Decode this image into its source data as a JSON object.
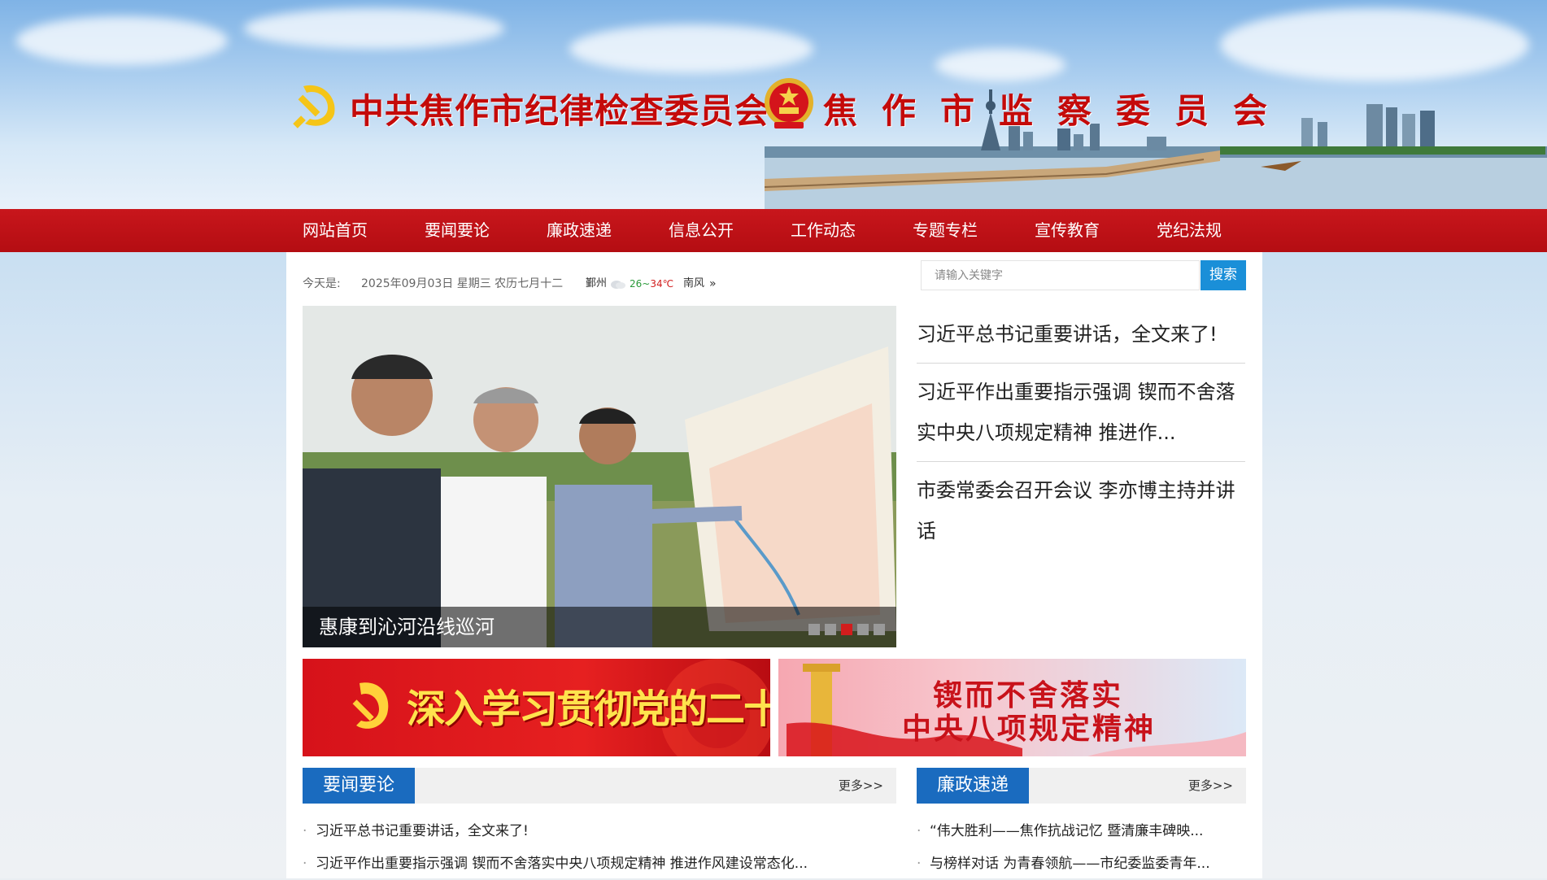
{
  "header": {
    "org_title_1": "中共焦作市纪律检查委员会",
    "org_title_2": "焦作市监察委员会"
  },
  "nav": {
    "items": [
      "网站首页",
      "要闻要论",
      "廉政速递",
      "信息公开",
      "工作动态",
      "专题专栏",
      "宣传教育",
      "党纪法规"
    ]
  },
  "datebar": {
    "label": "今天是:",
    "date": "2025年09月03日 星期三 农历七月十二",
    "city": "鄞州",
    "temp_low": "26",
    "temp_sep": "~",
    "temp_high": "34℃",
    "wind": "南风",
    "more": "»"
  },
  "search": {
    "placeholder": "请输入关键字",
    "button": "搜索"
  },
  "carousel": {
    "caption": "惠康到沁河沿线巡河",
    "active_index": 2,
    "slide_count": 5
  },
  "headlines": [
    "习近平总书记重要讲话，全文来了!",
    "习近平作出重要指示强调 锲而不舍落实中央八项规定精神 推进作...",
    "市委常委会召开会议 李亦博主持并讲话"
  ],
  "ads": {
    "ad1_text": "深入学习贯彻党的二十大精神",
    "ad2_line1": "锲而不舍落实",
    "ad2_line2": "中央八项规定精神"
  },
  "sections": {
    "left": {
      "title": "要闻要论",
      "more": "更多>>",
      "items": [
        "习近平总书记重要讲话，全文来了!",
        "习近平作出重要指示强调 锲而不舍落实中央八项规定精神 推进作风建设常态化..."
      ]
    },
    "right": {
      "title": "廉政速递",
      "more": "更多>>",
      "items": [
        "“伟大胜利——焦作抗战记忆 暨清廉丰碑映...",
        "与榜样对话 为青春领航——市纪委监委青年..."
      ]
    }
  },
  "colors": {
    "nav_red": "#c8161c",
    "title_red": "#c40a0a",
    "section_blue": "#1a6bbf",
    "search_blue": "#1a8fd8",
    "dot_active": "#d21d1d"
  }
}
